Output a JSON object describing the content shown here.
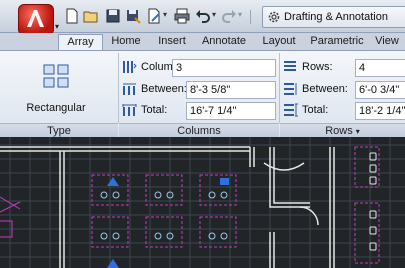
{
  "workspace": {
    "label": "Drafting & Annotation",
    "icon": "gear-icon"
  },
  "quick_access": [
    "new-icon",
    "open-icon",
    "save-icon",
    "save-as-icon",
    "plot-icon",
    "print-icon",
    "undo-icon",
    "redo-icon"
  ],
  "tabs": [
    {
      "label": "Array",
      "active": true
    },
    {
      "label": "Home"
    },
    {
      "label": "Insert"
    },
    {
      "label": "Annotate"
    },
    {
      "label": "Layout"
    },
    {
      "label": "Parametric"
    },
    {
      "label": "View"
    }
  ],
  "ribbon": {
    "type_panel": {
      "button": "Rectangular",
      "title": "Type"
    },
    "columns_panel": {
      "title": "Columns",
      "columns_label": "Columns:",
      "columns_value": "3",
      "between_label": "Between:",
      "between_value": "8'-3 5/8\"",
      "total_label": "Total:",
      "total_value": "16'-7 1/4\""
    },
    "rows_panel": {
      "title": "Rows",
      "rows_label": "Rows:",
      "rows_value": "4",
      "between_label": "Between:",
      "between_value": "6'-0 3/4\"",
      "total_label": "Total:",
      "total_value": "18'-2 1/4\""
    }
  },
  "colors": {
    "accent_red": "#c8261a",
    "canvas_bg": "#222528",
    "line_white": "#e6e6e6",
    "line_magenta": "#c23bc2",
    "selection_blue": "#2f6fe0"
  }
}
